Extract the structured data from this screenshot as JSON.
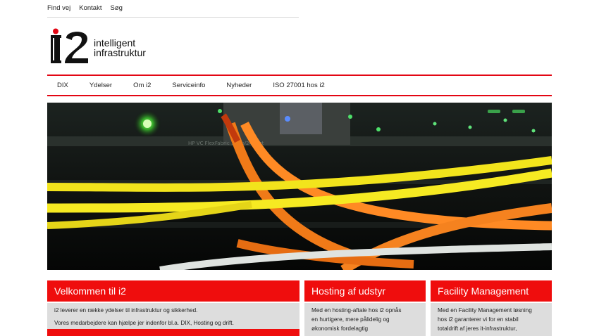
{
  "toplinks": [
    "Find vej",
    "Kontakt",
    "Søg"
  ],
  "logo": {
    "mark": "i2",
    "line1": "intelligent",
    "line2": "infrastruktur"
  },
  "nav": [
    "DIX",
    "Ydelser",
    "Om i2",
    "Serviceinfo",
    "Nyheder",
    "ISO 27001 hos i2"
  ],
  "hero": {
    "device_label": "HP VC FlexFabric 10Gb/24-Port"
  },
  "boxes": {
    "welcome": {
      "title": "Velkommen til i2",
      "line1": "i2 leverer en række ydelser til infrastruktur og sikkerhed.",
      "line2": "Vores medarbejdere kan hjælpe jer indenfor bl.a. DIX, Hosting og drift."
    },
    "hosting": {
      "title": "Hosting af udstyr",
      "line1": "Med en hosting-aftale hos i2 opnås",
      "line2": "en hurtigere, mere pålidelig og",
      "line3": "økonomisk fordelagtig"
    },
    "facility": {
      "title": "Facility Management",
      "line1": "Med en Facility Management løsning",
      "line2": "hos i2 garanterer vi for en stabil",
      "line3": "totaldrift af jeres it-infrastruktur,"
    }
  },
  "colors": {
    "brand_red": "#e30613",
    "box_red": "#ef0d0d",
    "box_grey": "#dddddd"
  }
}
